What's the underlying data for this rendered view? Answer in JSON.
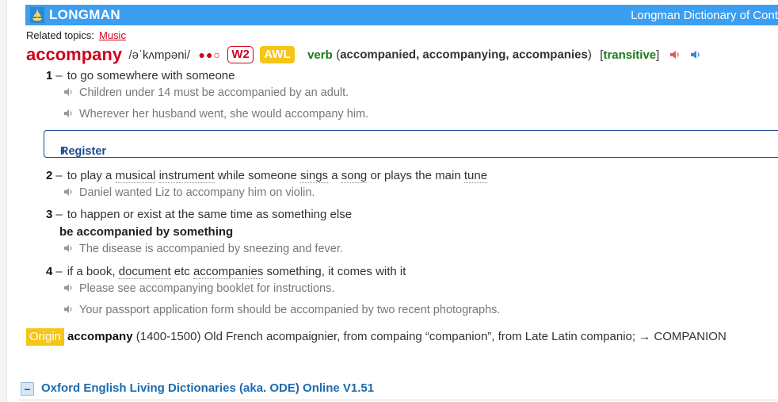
{
  "banner": {
    "logo": "LONGMAN",
    "dict_title": "Longman Dictionary of Cont",
    "color": "#3c9ef0",
    "logo_icon": "ship-icon"
  },
  "related": {
    "label": "Related topics:",
    "topic": "Music"
  },
  "entry": {
    "headword": "accompany",
    "pron": "/əˈkʌmpəni/",
    "freq_dots": "●●○",
    "w2": "W2",
    "awl": "AWL",
    "pos": "verb",
    "inflections_open": "(",
    "inflections": "accompanied, accompanying, accompanies",
    "inflections_close": ")",
    "gram_open": "[",
    "gram": "transitive",
    "gram_close": "]",
    "speaker_uk": "speaker-red-icon",
    "speaker_us": "speaker-blue-icon"
  },
  "senses": [
    {
      "num": "1",
      "dash": "–",
      "def": "to go somewhere with someone",
      "examples": [
        "Children under 14 must be accompanied by an adult.",
        "Wherever her husband went, she would accompany him."
      ]
    },
    {
      "num": "2",
      "dash": "–",
      "def_parts": [
        "to play a ",
        "musical",
        " ",
        "instrument",
        " while someone ",
        "sings",
        " a ",
        "song",
        " or plays the main ",
        "tune"
      ],
      "examples": [
        "Daniel wanted Liz to accompany him on violin."
      ]
    },
    {
      "num": "3",
      "dash": "–",
      "def": "to happen or exist at the same time as something else",
      "collocation": "be accompanied by something",
      "examples": [
        "The disease is accompanied by sneezing and fever."
      ]
    },
    {
      "num": "4",
      "dash": "–",
      "def_parts": [
        "if a book, ",
        "document",
        " etc ",
        "accompanies",
        " something, it comes with it"
      ],
      "examples": [
        "Please see accompanying booklet for instructions.",
        "Your passport application form should be accompanied by two recent photographs."
      ]
    }
  ],
  "register": {
    "plus": "+",
    "label": "Register"
  },
  "origin": {
    "tag": "Origin",
    "word": "accompany",
    "text": " (1400-1500) Old French acompaignier, from compaing “companion”, from Late Latin companio; → COMPANION"
  },
  "oxford": {
    "minus": "–",
    "label": "Oxford English Living Dictionaries (aka. ODE) Online V1.51"
  }
}
